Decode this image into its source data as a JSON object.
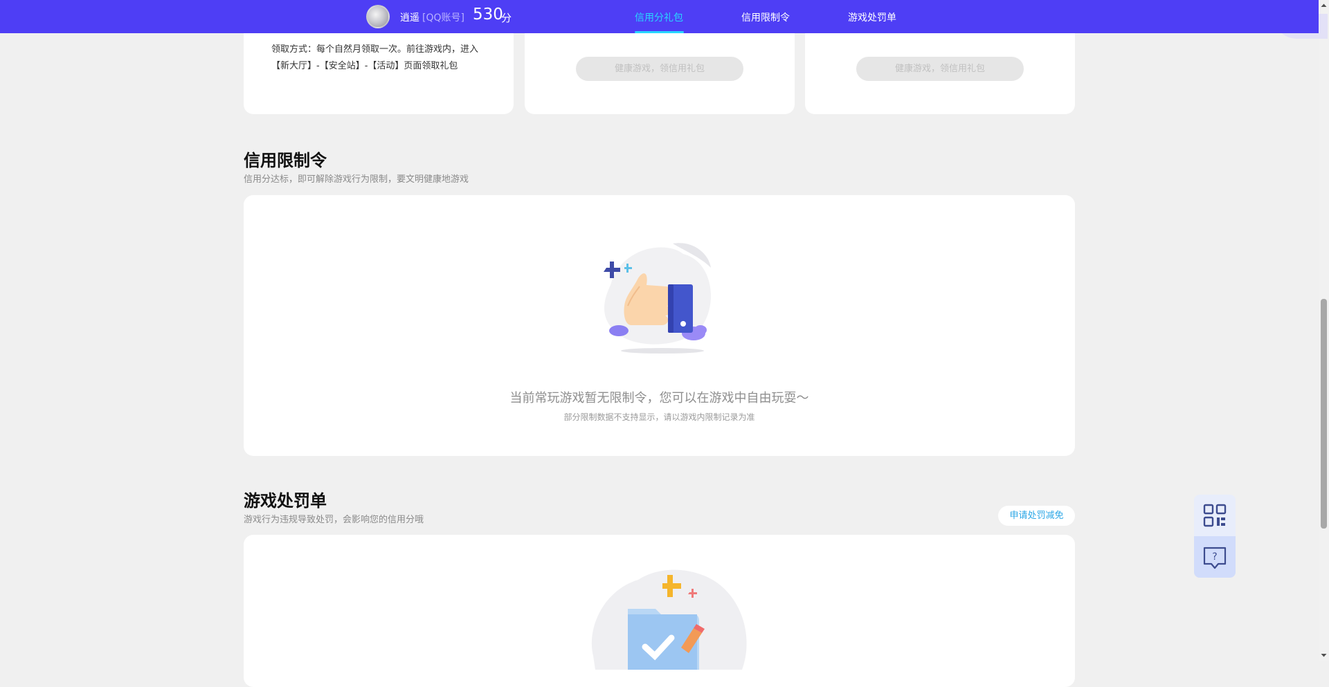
{
  "header": {
    "username": "逍遥",
    "account_type": "[QQ账号]",
    "score": "530",
    "score_unit": "分",
    "tabs": [
      {
        "label": "信用分礼包",
        "active": true
      },
      {
        "label": "信用限制令",
        "active": false
      },
      {
        "label": "游戏处罚单",
        "active": false
      }
    ]
  },
  "gift_cards": {
    "claim_text": "领取方式：每个自然月领取一次。前往游戏内，进入【新大厅】-【安全站】-【活动】页面领取礼包",
    "disabled_button_1": "健康游戏，领信用礼包",
    "disabled_button_2": "健康游戏，领信用礼包"
  },
  "restriction": {
    "title": "信用限制令",
    "subtitle": "信用分达标，即可解除游戏行为限制，要文明健康地游戏",
    "empty_message": "当前常玩游戏暂无限制令，您可以在游戏中自由玩耍～",
    "empty_note": "部分限制数据不支持显示，请以游戏内限制记录为准"
  },
  "penalty": {
    "title": "游戏处罚单",
    "subtitle": "游戏行为违规导致处罚，会影响您的信用分哦",
    "apply_button": "申请处罚减免"
  },
  "colors": {
    "nav_bg": "#4e3ef5",
    "active_tab": "#29d6ff",
    "page_bg": "#f0f0f0",
    "link": "#2aa6e6"
  },
  "icons": {
    "qr": "qr-code-icon",
    "help": "help-chat-icon",
    "thumbs_up": "thumbs-up-illustration",
    "folder": "folder-check-illustration"
  }
}
